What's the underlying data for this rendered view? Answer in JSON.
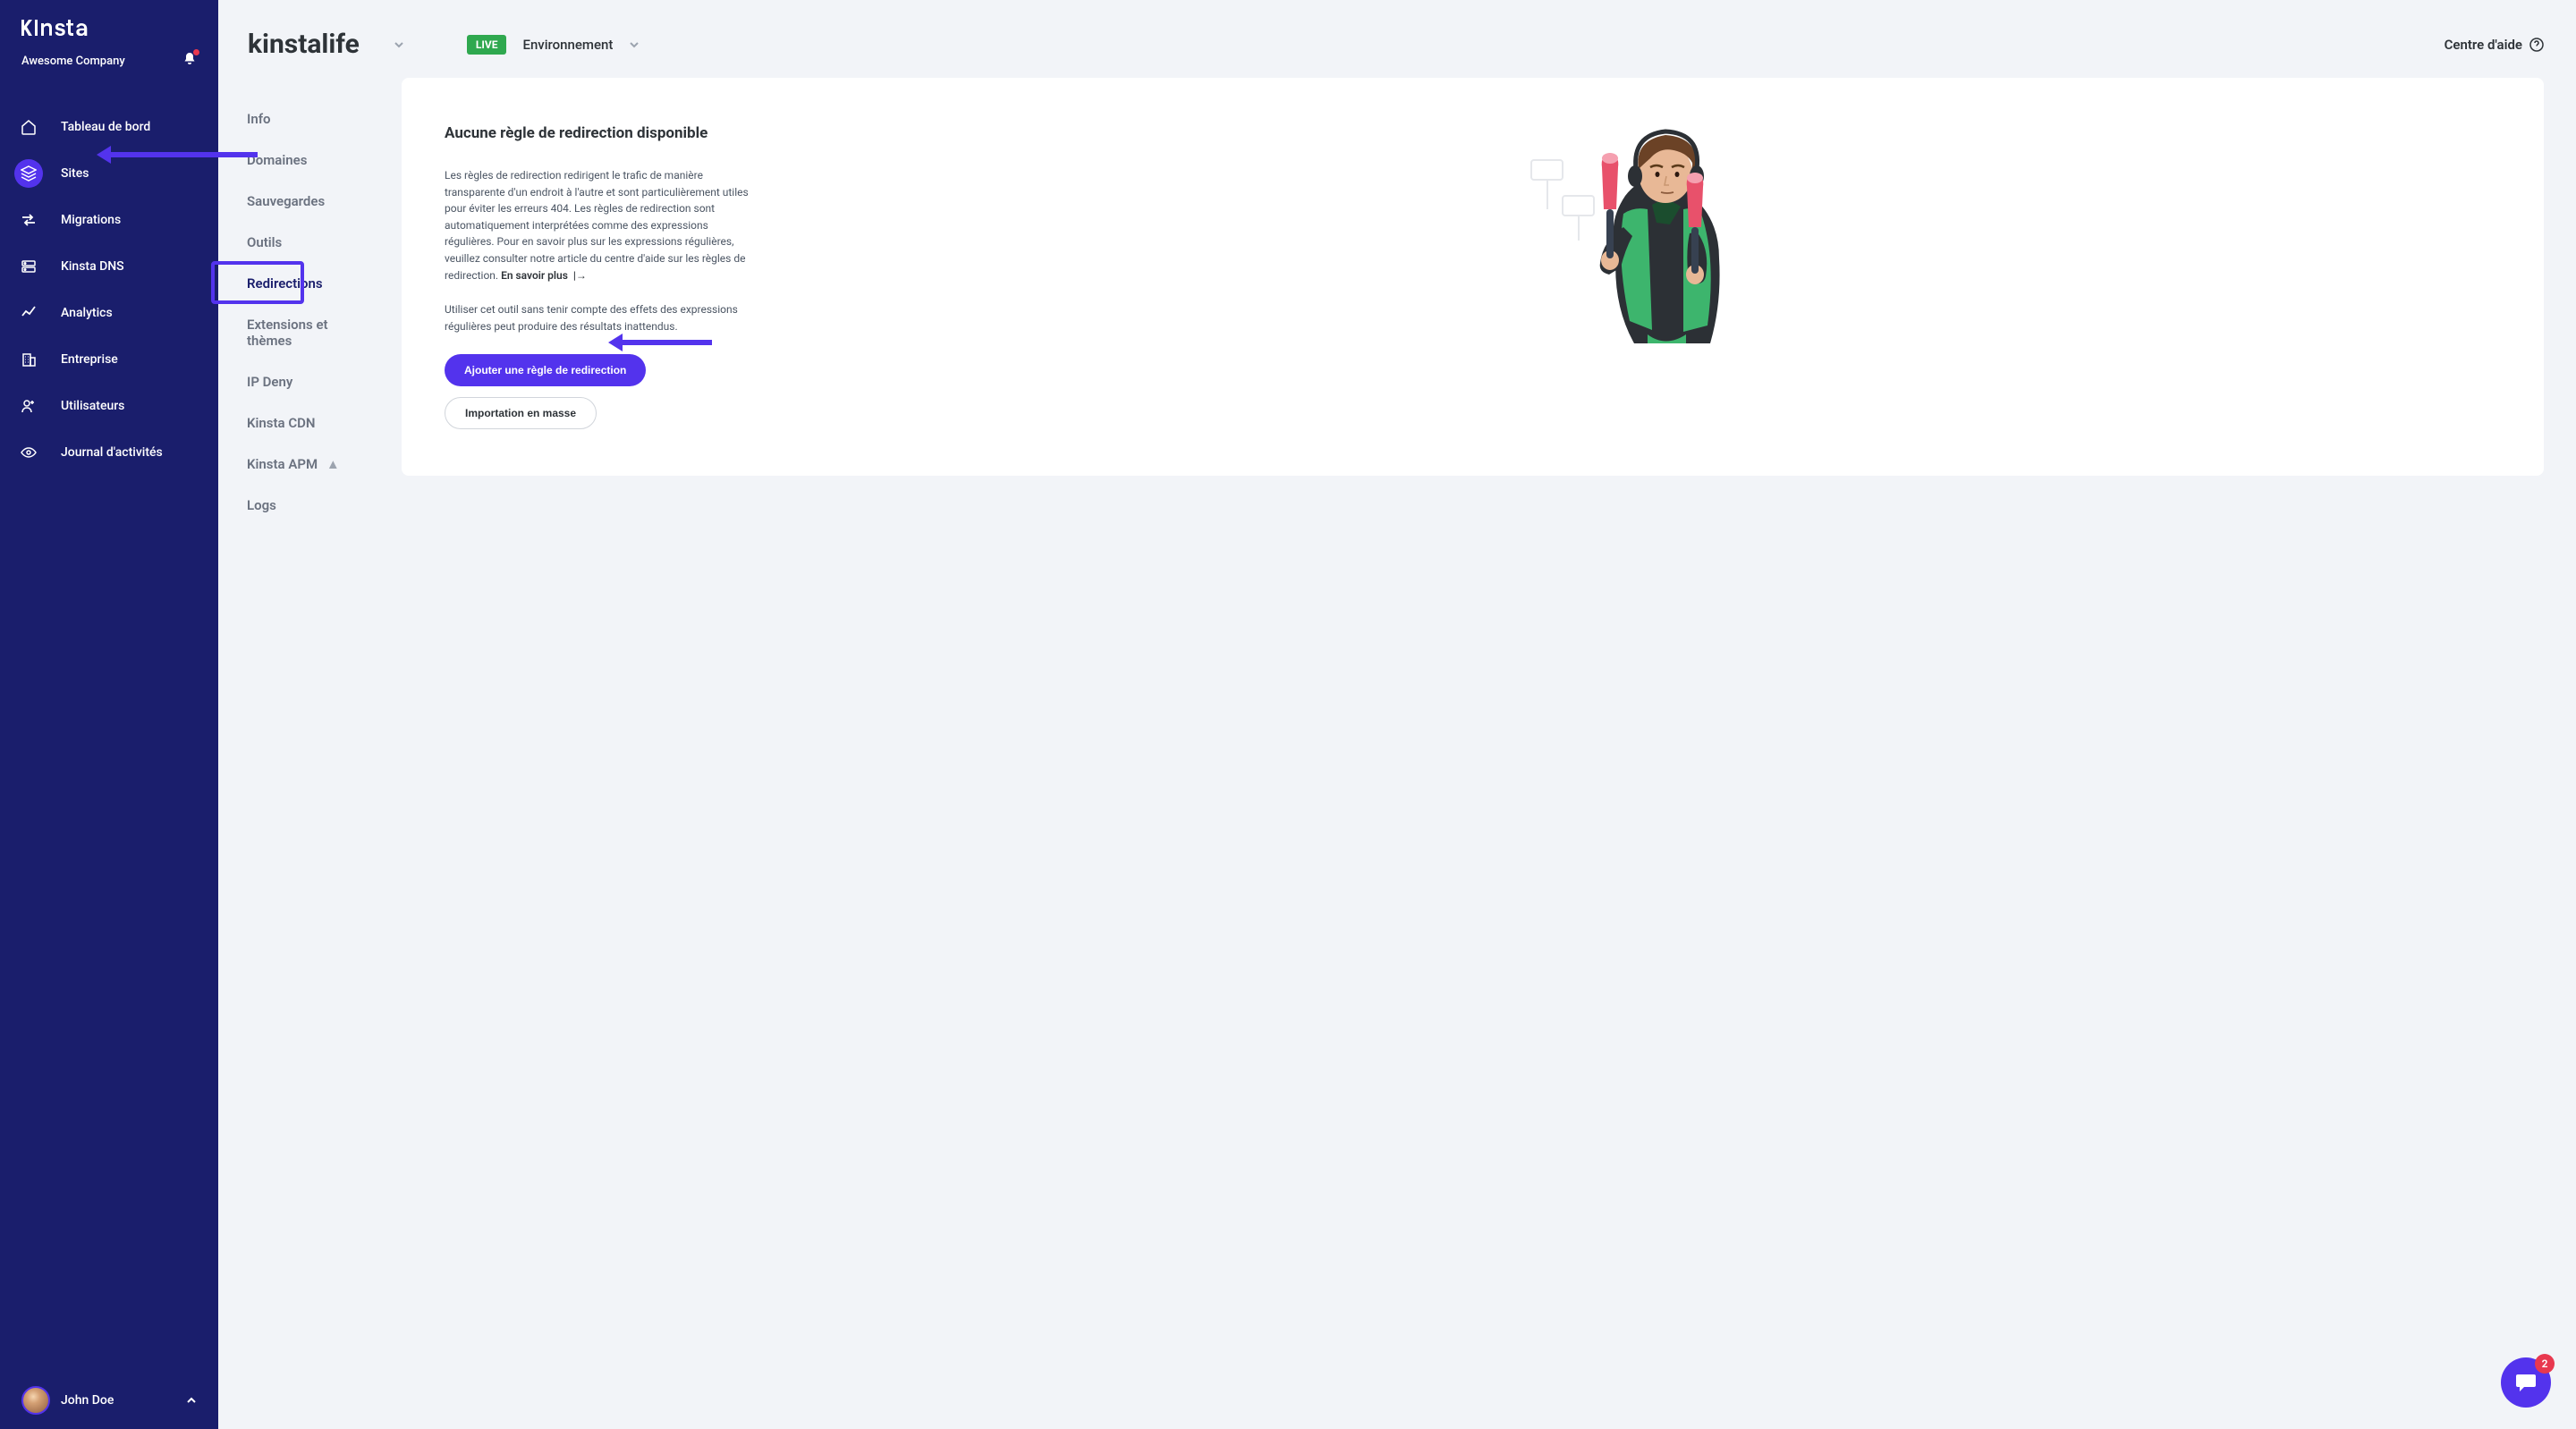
{
  "brand": {
    "logo": "KINSTA"
  },
  "company": {
    "name": "Awesome Company"
  },
  "nav": [
    {
      "label": "Tableau de bord",
      "icon": "dashboard"
    },
    {
      "label": "Sites",
      "icon": "sites"
    },
    {
      "label": "Migrations",
      "icon": "migrations"
    },
    {
      "label": "Kinsta DNS",
      "icon": "dns"
    },
    {
      "label": "Analytics",
      "icon": "analytics"
    },
    {
      "label": "Entreprise",
      "icon": "enterprise"
    },
    {
      "label": "Utilisateurs",
      "icon": "users"
    },
    {
      "label": "Journal d'activités",
      "icon": "activity"
    }
  ],
  "user": {
    "name": "John Doe"
  },
  "site": {
    "name": "kinstalife"
  },
  "env": {
    "badge": "LIVE",
    "label": "Environnement"
  },
  "helpcenter": {
    "label": "Centre d'aide"
  },
  "secnav": [
    {
      "label": "Info"
    },
    {
      "label": "Domaines"
    },
    {
      "label": "Sauvegardes"
    },
    {
      "label": "Outils"
    },
    {
      "label": "Redirections"
    },
    {
      "label": "Extensions et thèmes"
    },
    {
      "label": "IP Deny"
    },
    {
      "label": "Kinsta CDN"
    },
    {
      "label": "Kinsta APM"
    },
    {
      "label": "Logs"
    }
  ],
  "card": {
    "title": "Aucune règle de redirection disponible",
    "text1": "Les règles de redirection redirigent le trafic de manière transparente d'un endroit à l'autre et sont particulièrement utiles pour éviter les erreurs 404. Les règles de redirection sont automatiquement interprétées comme des expressions régulières. Pour en savoir plus sur les expressions régulières, veuillez consulter notre article du centre d'aide sur les règles de redirection. ",
    "learnmore": "En savoir plus",
    "text2": "Utiliser cet outil sans tenir compte des effets des expressions régulières peut produire des résultats inattendus.",
    "btn_add": "Ajouter une règle de redirection",
    "btn_import": "Importation en masse"
  },
  "chat": {
    "count": "2"
  }
}
